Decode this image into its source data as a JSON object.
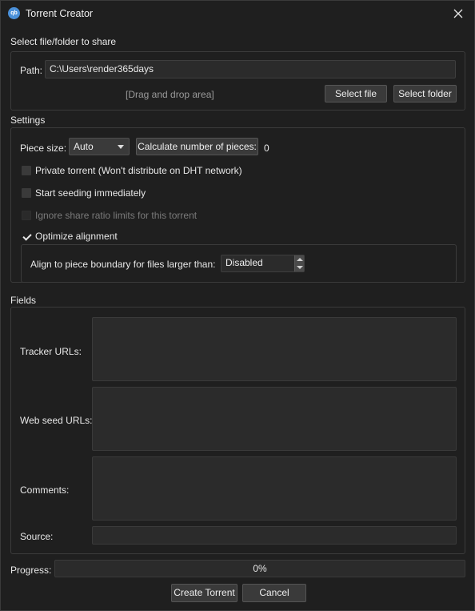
{
  "window": {
    "title": "Torrent Creator",
    "app_icon_text": "qb"
  },
  "share": {
    "section_label": "Select file/folder to share",
    "path_label": "Path:",
    "path_value": "C:\\Users\\render365days",
    "drop_area_text": "[Drag and drop area]",
    "select_file_label": "Select file",
    "select_folder_label": "Select folder"
  },
  "settings": {
    "section_label": "Settings",
    "piece_size_label": "Piece size:",
    "piece_size_value": "Auto",
    "calculate_label": "Calculate number of pieces:",
    "pieces_count": "0",
    "private_torrent": {
      "label": "Private torrent (Won't distribute on DHT network)",
      "checked": false
    },
    "start_seeding": {
      "label": "Start seeding immediately",
      "checked": false
    },
    "ignore_share_ratio": {
      "label": "Ignore share ratio limits for this torrent",
      "checked": false,
      "disabled": true
    },
    "optimize_alignment": {
      "label": "Optimize alignment",
      "checked": true
    },
    "align_label": "Align to piece boundary for files larger than:",
    "align_value": "Disabled"
  },
  "fields": {
    "section_label": "Fields",
    "tracker_urls_label": "Tracker URLs:",
    "web_seed_urls_label": "Web seed URLs:",
    "comments_label": "Comments:",
    "source_label": "Source:"
  },
  "progress": {
    "label": "Progress:",
    "value": 0,
    "text": "0%"
  },
  "footer": {
    "create_label": "Create Torrent",
    "cancel_label": "Cancel"
  },
  "colors": {
    "accent": "#4a90d9",
    "background": "#1f1f1f",
    "field": "#2b2b2b"
  }
}
